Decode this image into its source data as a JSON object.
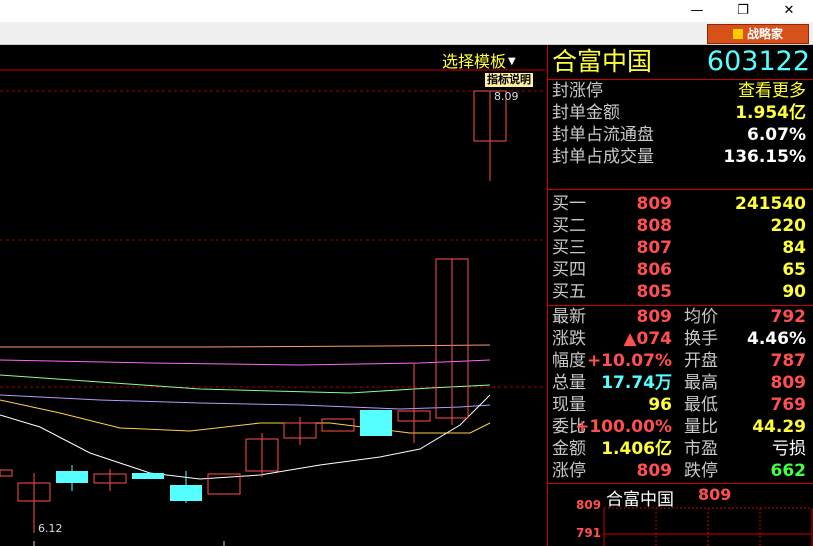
{
  "window": {
    "minimize": "—",
    "restore": "❐",
    "close": "✕"
  },
  "toolbar": {
    "brand_label": "战略家"
  },
  "chart": {
    "template_select": "选择模板",
    "indicator_help": "指标说明",
    "high_label": "8.09",
    "low_label": "6.12"
  },
  "header": {
    "name": "合富中国",
    "code": "603122"
  },
  "limit": {
    "title": "封涨停",
    "more": "查看更多",
    "rows": [
      {
        "label": "封单金额",
        "value": "1.954亿"
      },
      {
        "label": "封单占流通盘",
        "value": "6.07%"
      },
      {
        "label": "封单占成交量",
        "value": "136.15%"
      }
    ]
  },
  "orderbook": [
    {
      "label": "买一",
      "price": "809",
      "volume": "241540"
    },
    {
      "label": "买二",
      "price": "808",
      "volume": "220"
    },
    {
      "label": "买三",
      "price": "807",
      "volume": "84"
    },
    {
      "label": "买四",
      "price": "806",
      "volume": "65"
    },
    {
      "label": "买五",
      "price": "805",
      "volume": "90"
    }
  ],
  "quote": {
    "rows": [
      {
        "l1": "最新",
        "v1": "809",
        "l2": "均价",
        "v2": "792"
      },
      {
        "l1": "涨跌",
        "v1": "▲074",
        "l2": "换手",
        "v2": "4.46%"
      },
      {
        "l1": "幅度",
        "v1": "+10.07%",
        "l2": "开盘",
        "v2": "787"
      },
      {
        "l1": "总量",
        "v1": "17.74万",
        "l2": "最高",
        "v2": "809"
      },
      {
        "l1": "现量",
        "v1": "96",
        "l2": "最低",
        "v2": "769"
      },
      {
        "l1": "委比",
        "v1": "+100.00%",
        "l2": "量比",
        "v2": "44.29"
      },
      {
        "l1": "金额",
        "v1": "1.406亿",
        "l2": "市盈",
        "v2": "亏损"
      },
      {
        "l1": "涨停",
        "v1": "809",
        "l2": "跌停",
        "v2": "662"
      }
    ]
  },
  "mini": {
    "name": "合富中国",
    "price": "809",
    "axis_top": "809",
    "axis_bottom": "791"
  },
  "colors": {
    "up": "#ff5050",
    "down": "#55ffff",
    "divider": "#cc0000"
  }
}
